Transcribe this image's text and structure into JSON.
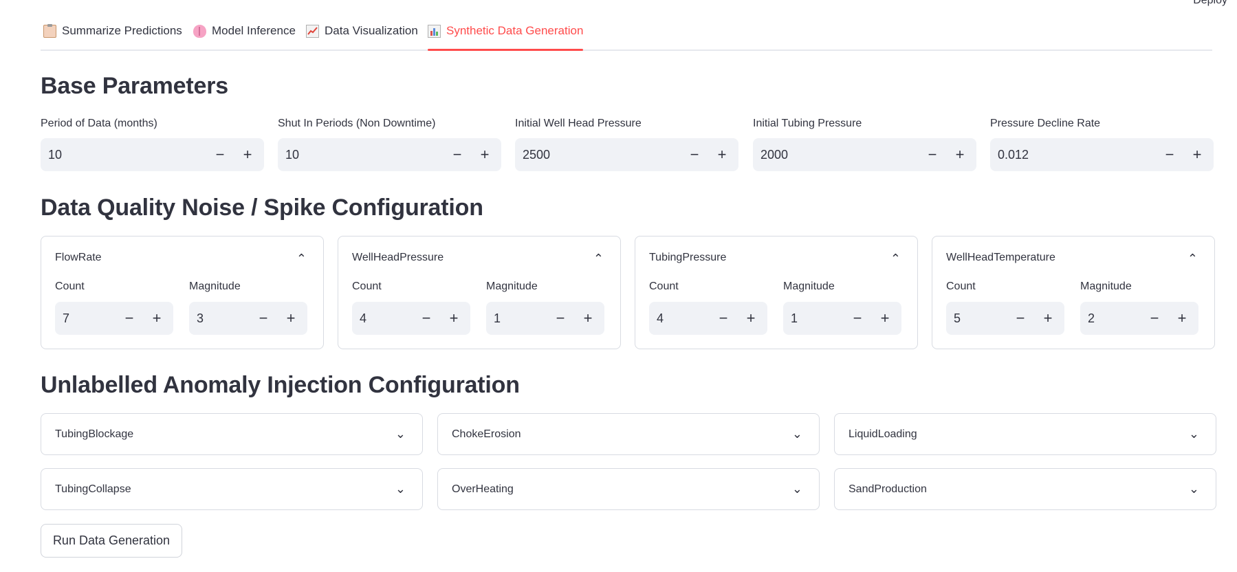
{
  "header": {
    "deploy_label": "Deploy"
  },
  "tabs": [
    {
      "label": "Summarize Predictions",
      "icon": "clipboard-icon"
    },
    {
      "label": "Model Inference",
      "icon": "brain-icon"
    },
    {
      "label": "Data Visualization",
      "icon": "chart-increasing-icon"
    },
    {
      "label": "Synthetic Data Generation",
      "icon": "bar-chart-icon",
      "active": true
    }
  ],
  "base": {
    "heading": "Base Parameters",
    "fields": [
      {
        "label": "Period of Data (months)",
        "value": "10"
      },
      {
        "label": "Shut In Periods (Non Downtime)",
        "value": "10"
      },
      {
        "label": "Initial Well Head Pressure",
        "value": "2500"
      },
      {
        "label": "Initial Tubing Pressure",
        "value": "2000"
      },
      {
        "label": "Pressure Decline Rate",
        "value": "0.012"
      }
    ]
  },
  "noise": {
    "heading": "Data Quality Noise / Spike Configuration",
    "count_label": "Count",
    "magnitude_label": "Magnitude",
    "cards": [
      {
        "title": "FlowRate",
        "count": "7",
        "magnitude": "3"
      },
      {
        "title": "WellHeadPressure",
        "count": "4",
        "magnitude": "1"
      },
      {
        "title": "TubingPressure",
        "count": "4",
        "magnitude": "1"
      },
      {
        "title": "WellHeadTemperature",
        "count": "5",
        "magnitude": "2"
      }
    ]
  },
  "anomaly": {
    "heading": "Unlabelled Anomaly Injection Configuration",
    "items": [
      "TubingBlockage",
      "ChokeErosion",
      "LiquidLoading",
      "TubingCollapse",
      "OverHeating",
      "SandProduction"
    ]
  },
  "stepper": {
    "minus": "−",
    "plus": "+"
  },
  "chevrons": {
    "up": "⌃",
    "down": "⌄"
  },
  "actions": {
    "run_label": "Run Data Generation"
  },
  "colors": {
    "accent": "#ff4b4b",
    "text": "#31333f",
    "input_bg": "#f0f2f6",
    "border": "#d8dbe2"
  }
}
